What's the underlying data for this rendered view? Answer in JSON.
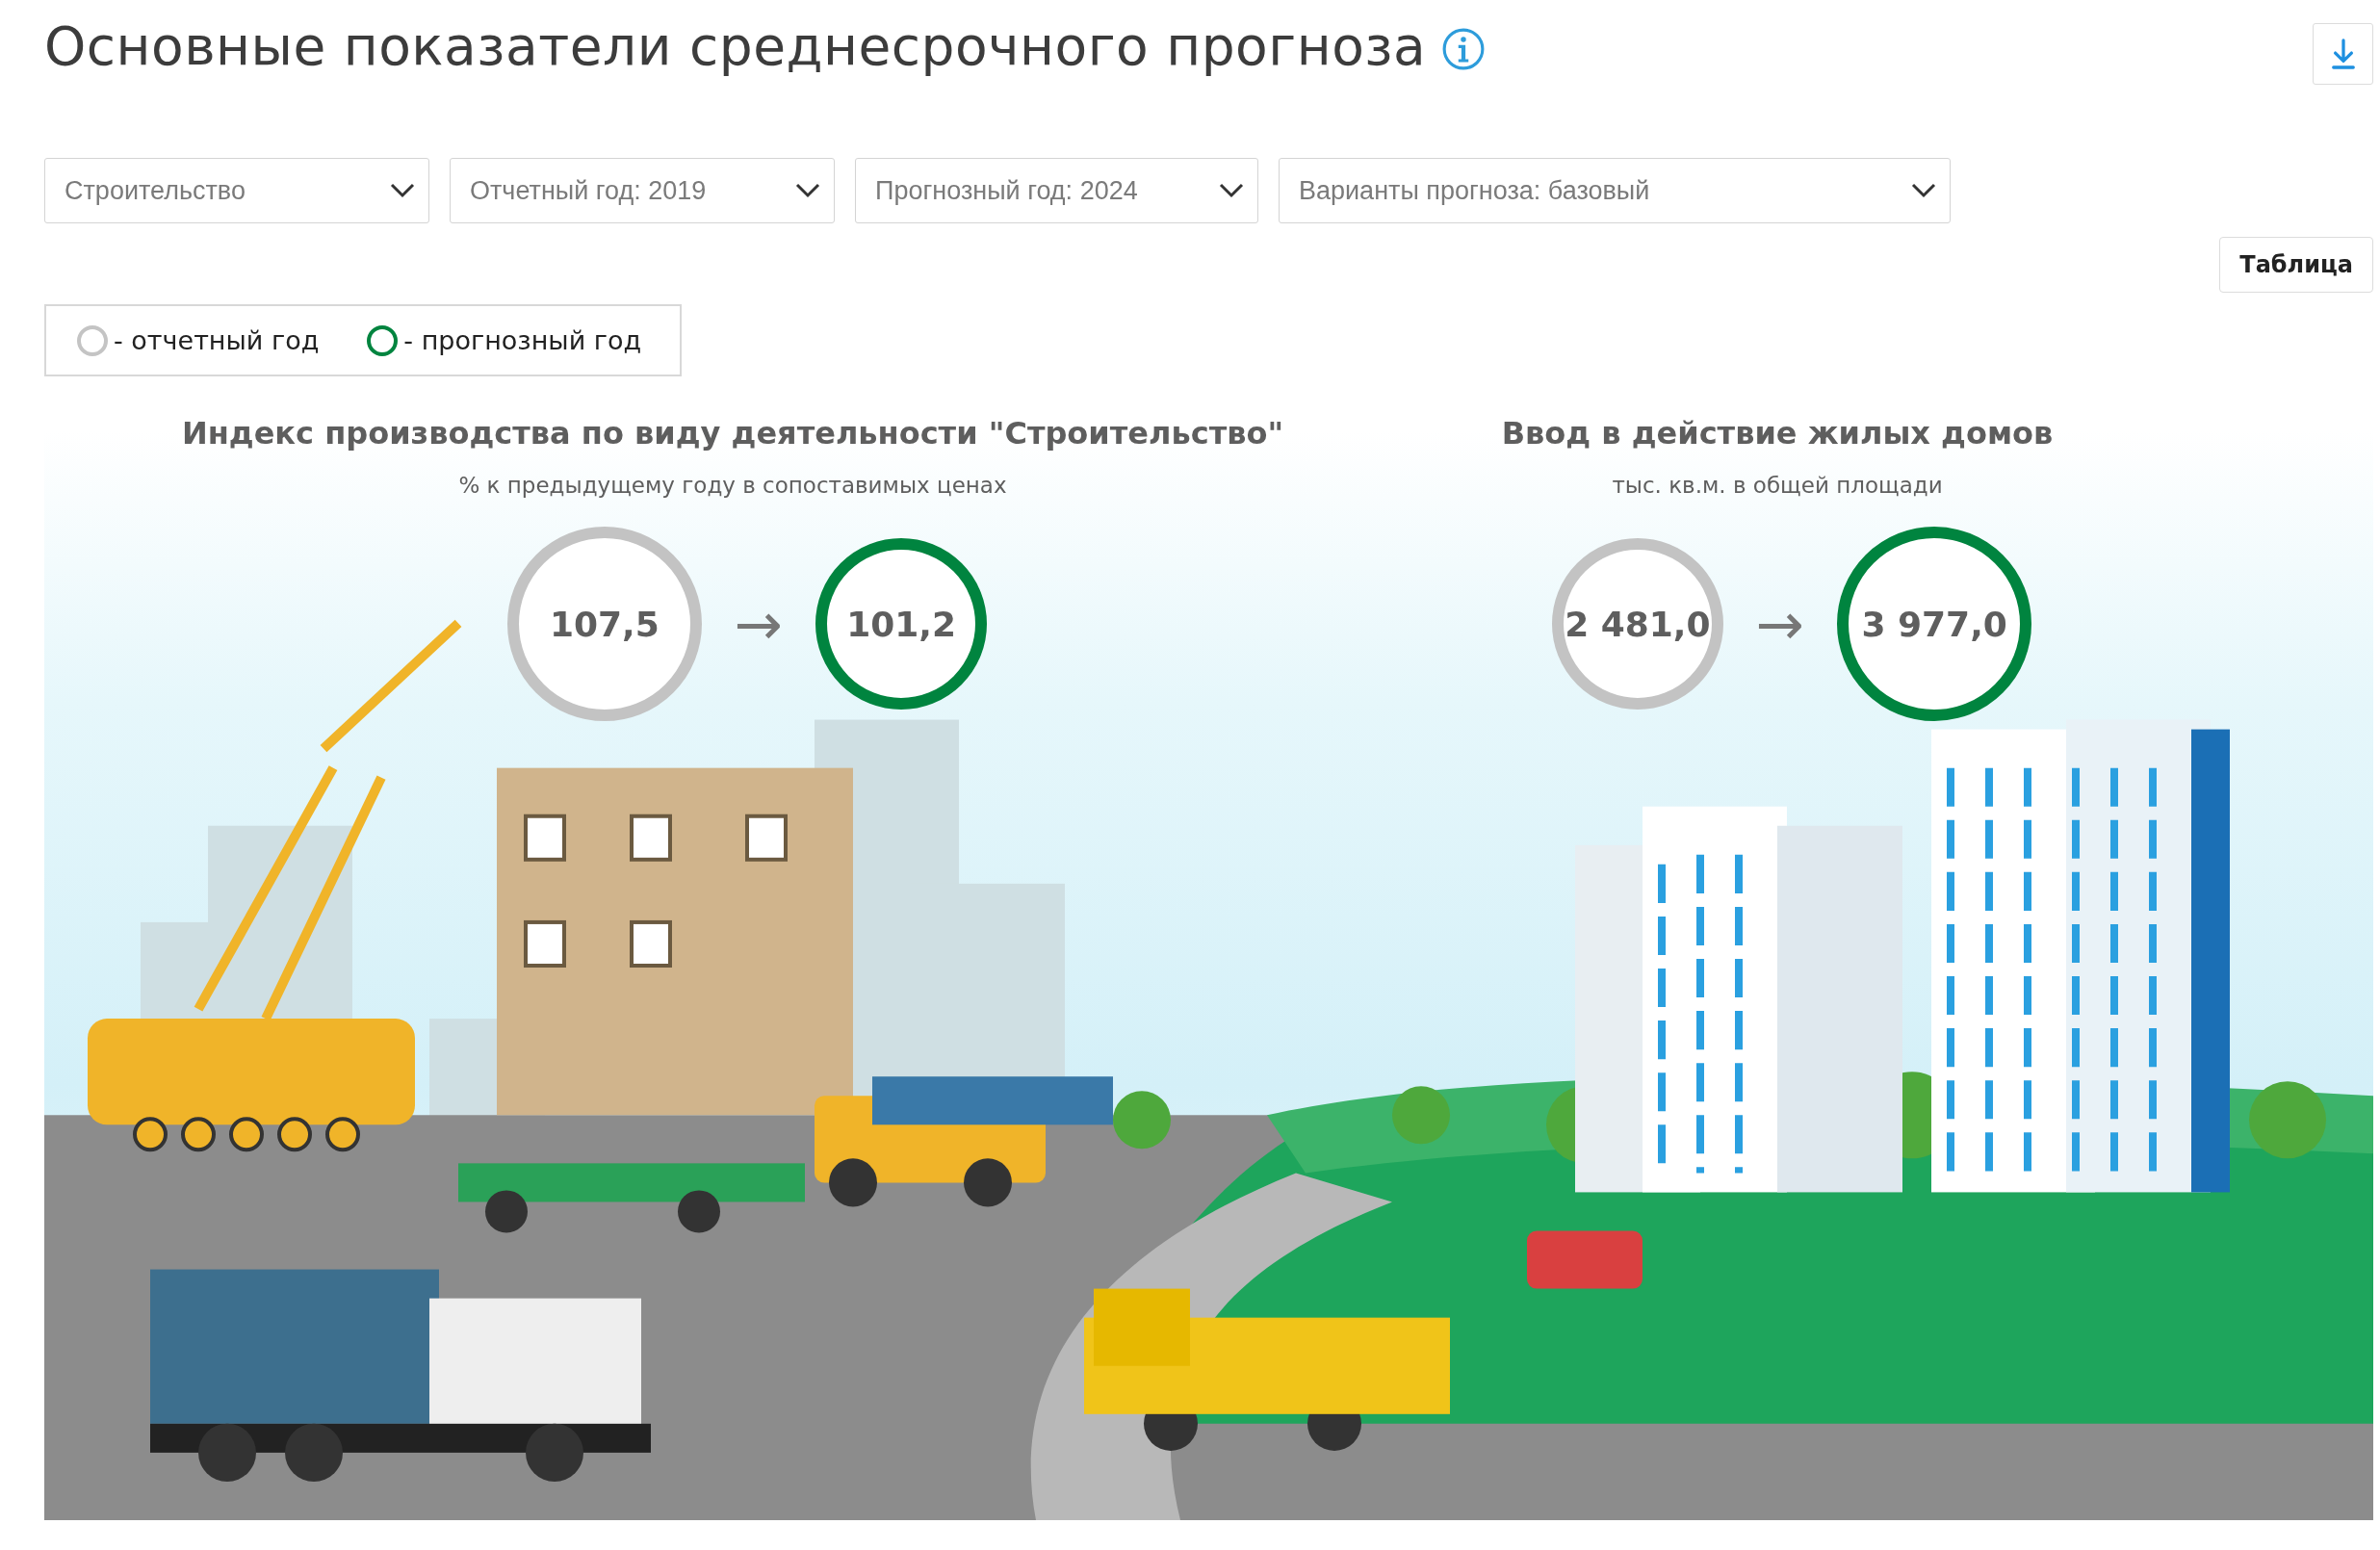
{
  "header": {
    "title": "Основные показатели среднесрочного прогноза"
  },
  "filters": [
    {
      "label": "Строительство"
    },
    {
      "label": "Отчетный год: 2019"
    },
    {
      "label": "Прогнозный год: 2024"
    },
    {
      "label": "Варианты прогноза: базовый"
    }
  ],
  "table_button": "Таблица",
  "legend": [
    {
      "label": "- отчетный год",
      "color": "#c4c4c4"
    },
    {
      "label": "- прогнозный год",
      "color": "#00843f"
    }
  ],
  "indicators": [
    {
      "title": "Индекс производства по виду деятельности \"Строительство\"",
      "subtitle": "% к предыдущему году в сопоставимых ценах",
      "arrow": "→",
      "values": [
        {
          "kind": "reported",
          "value": "107,5",
          "large": true
        },
        {
          "kind": "forecast",
          "value": "101,2",
          "large": false
        }
      ]
    },
    {
      "title": "Ввод в действие жилых домов",
      "subtitle": "тыс. кв.м. в общей площади",
      "arrow": "→",
      "values": [
        {
          "kind": "reported",
          "value": "2 481,0",
          "large": false
        },
        {
          "kind": "forecast",
          "value": "3 977,0",
          "large": true
        }
      ]
    }
  ]
}
